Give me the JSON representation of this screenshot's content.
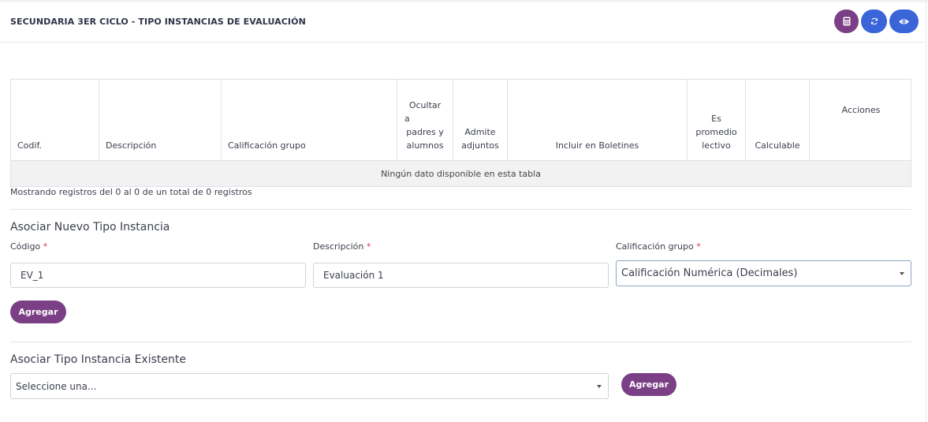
{
  "header": {
    "title": "SECUNDARIA 3ER CICLO - TIPO INSTANCIAS DE EVALUACIÓN",
    "buttons": {
      "calc_icon": "calculator-icon",
      "sync_icon": "sync-icon",
      "view_icon": "eye-icon"
    },
    "colors": {
      "purple": "#7b3f86",
      "blue": "#3a65d9"
    }
  },
  "table": {
    "columns": {
      "codif": "Codif.",
      "descripcion": "Descripción",
      "calificacion_grupo": "Calificación grupo",
      "ocultar": [
        "Ocultar",
        "a",
        "padres y",
        "alumnos"
      ],
      "admite": [
        "Admite",
        "adjuntos"
      ],
      "incluir": "Incluir en Boletines",
      "promedio": [
        "Es",
        "promedio",
        "lectivo"
      ],
      "calculable": "Calculable",
      "acciones": "Acciones"
    },
    "empty_message": "Ningún dato disponible en esta tabla",
    "info": "Mostrando registros del 0 al 0 de un total de 0 registros"
  },
  "nuevo": {
    "title": "Asociar Nuevo Tipo Instancia",
    "codigo_label": "Código",
    "codigo_value": "EV_1",
    "descripcion_label": "Descripción",
    "descripcion_value": "Evaluación 1",
    "calificacion_label": "Calificación grupo",
    "calificacion_value": "Calificación Numérica (Decimales)",
    "required_mark": "*",
    "add_label": "Agregar"
  },
  "existente": {
    "title": "Asociar Tipo Instancia Existente",
    "select_value": "Seleccione una...",
    "add_label": "Agregar"
  }
}
